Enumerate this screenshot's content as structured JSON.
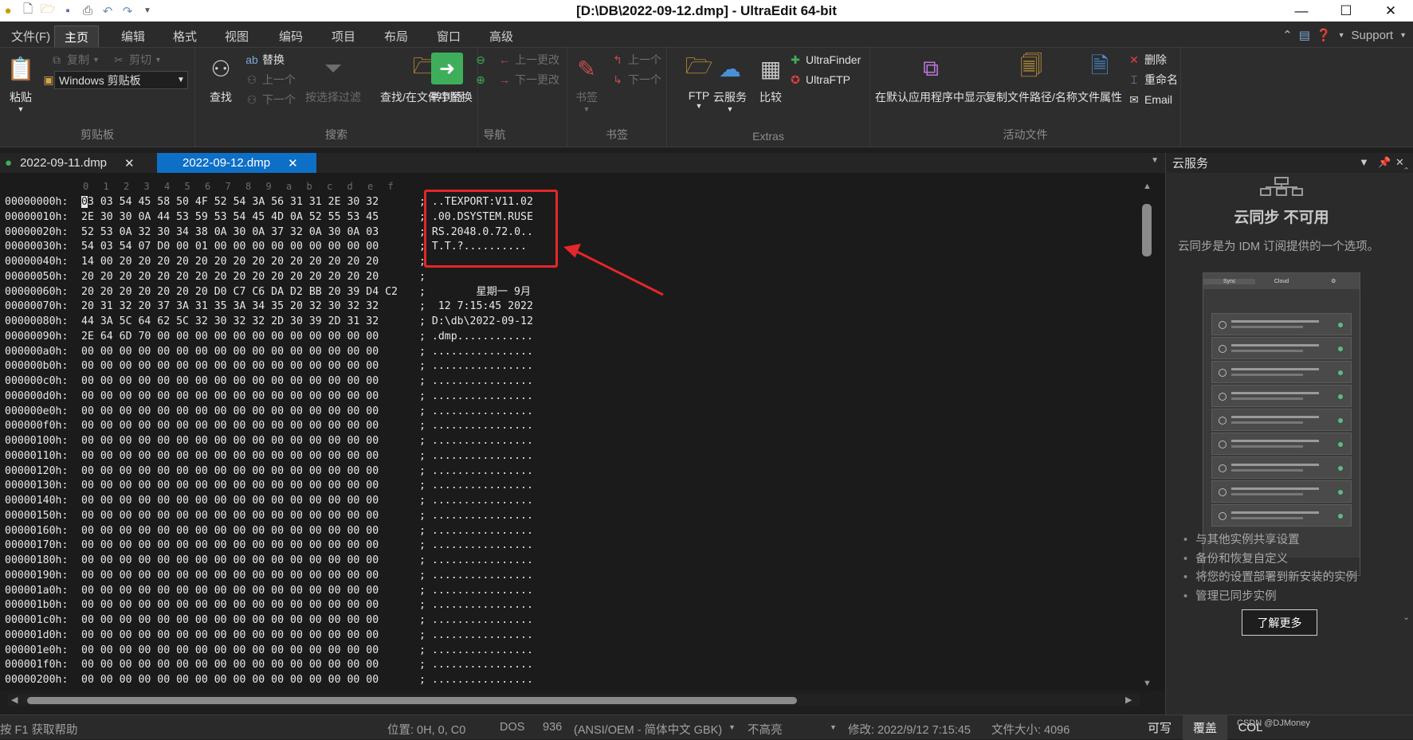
{
  "window": {
    "title": "[D:\\DB\\2022-09-12.dmp] - UltraEdit 64-bit",
    "controls": [
      "—",
      "☐",
      "✕"
    ]
  },
  "menu": {
    "tabs": [
      "文件(F)",
      "主页",
      "编辑",
      "格式",
      "视图",
      "编码",
      "项目",
      "布局",
      "窗口",
      "高级"
    ],
    "active": "主页",
    "support": "Support"
  },
  "ribbon": {
    "clipboard": {
      "label": "剪贴板",
      "paste": "粘贴",
      "copy": "复制",
      "cut": "剪切",
      "combo": "Windows 剪贴板"
    },
    "search": {
      "label": "搜索",
      "find": "查找",
      "replace": "替换",
      "prev": "上一个",
      "next": "下一个",
      "filter": "按选择过滤",
      "find_in_files": "查找/在文件中替换"
    },
    "navigation": {
      "label": "导航",
      "goto": "转到行",
      "prev_change": "上一更改",
      "next_change": "下一更改"
    },
    "bookmarks": {
      "label": "书签",
      "bookmark": "书签",
      "prev": "上一个",
      "next": "下一个"
    },
    "extras": {
      "label": "Extras",
      "ftp": "FTP",
      "cloud": "云服务",
      "compare": "比较",
      "ultrafinder": "UltraFinder",
      "ultraftp": "UltraFTP"
    },
    "active_file": {
      "label": "活动文件",
      "show_default": "在默认应用程序中显示",
      "copy_path": "复制文件路径/名称",
      "properties": "文件属性",
      "delete": "删除",
      "rename": "重命名",
      "email": "Email"
    }
  },
  "documents": [
    {
      "name": "2022-09-11.dmp",
      "active": false
    },
    {
      "name": "2022-09-12.dmp",
      "active": true
    }
  ],
  "editor": {
    "ruler": [
      "0",
      "1",
      "2",
      "3",
      "4",
      "5",
      "6",
      "7",
      "8",
      "9",
      "a",
      "b",
      "c",
      "d",
      "e",
      "f"
    ],
    "rows": [
      {
        "addr": "00000000h:",
        "hex": "03 03 54 45 58 50 4F 52 54 3A 56 31 31 2E 30 32",
        "ascii": "..TEXPORT:V11.02"
      },
      {
        "addr": "00000010h:",
        "hex": "2E 30 30 0A 44 53 59 53 54 45 4D 0A 52 55 53 45",
        "ascii": ".00.DSYSTEM.RUSE"
      },
      {
        "addr": "00000020h:",
        "hex": "52 53 0A 32 30 34 38 0A 30 0A 37 32 0A 30 0A 03",
        "ascii": "RS.2048.0.72.0.."
      },
      {
        "addr": "00000030h:",
        "hex": "54 03 54 07 D0 00 01 00 00 00 00 00 00 00 00 00",
        "ascii": "T.T.?.........."
      },
      {
        "addr": "00000040h:",
        "hex": "14 00 20 20 20 20 20 20 20 20 20 20 20 20 20 20",
        "ascii": ""
      },
      {
        "addr": "00000050h:",
        "hex": "20 20 20 20 20 20 20 20 20 20 20 20 20 20 20 20",
        "ascii": ""
      },
      {
        "addr": "00000060h:",
        "hex": "20 20 20 20 20 20 20 D0 C7 C6 DA D2 BB 20 39 D4 C2",
        "ascii": "       星期一 9月"
      },
      {
        "addr": "00000070h:",
        "hex": "20 31 32 20 37 3A 31 35 3A 34 35 20 32 30 32 32",
        "ascii": " 12 7:15:45 2022"
      },
      {
        "addr": "00000080h:",
        "hex": "44 3A 5C 64 62 5C 32 30 32 32 2D 30 39 2D 31 32",
        "ascii": "D:\\db\\2022-09-12"
      },
      {
        "addr": "00000090h:",
        "hex": "2E 64 6D 70 00 00 00 00 00 00 00 00 00 00 00 00",
        "ascii": ".dmp............"
      },
      {
        "addr": "000000a0h:",
        "hex": "00 00 00 00 00 00 00 00 00 00 00 00 00 00 00 00",
        "ascii": "................"
      },
      {
        "addr": "000000b0h:",
        "hex": "00 00 00 00 00 00 00 00 00 00 00 00 00 00 00 00",
        "ascii": "................"
      },
      {
        "addr": "000000c0h:",
        "hex": "00 00 00 00 00 00 00 00 00 00 00 00 00 00 00 00",
        "ascii": "................"
      },
      {
        "addr": "000000d0h:",
        "hex": "00 00 00 00 00 00 00 00 00 00 00 00 00 00 00 00",
        "ascii": "................"
      },
      {
        "addr": "000000e0h:",
        "hex": "00 00 00 00 00 00 00 00 00 00 00 00 00 00 00 00",
        "ascii": "................"
      },
      {
        "addr": "000000f0h:",
        "hex": "00 00 00 00 00 00 00 00 00 00 00 00 00 00 00 00",
        "ascii": "................"
      },
      {
        "addr": "00000100h:",
        "hex": "00 00 00 00 00 00 00 00 00 00 00 00 00 00 00 00",
        "ascii": "................"
      },
      {
        "addr": "00000110h:",
        "hex": "00 00 00 00 00 00 00 00 00 00 00 00 00 00 00 00",
        "ascii": "................"
      },
      {
        "addr": "00000120h:",
        "hex": "00 00 00 00 00 00 00 00 00 00 00 00 00 00 00 00",
        "ascii": "................"
      },
      {
        "addr": "00000130h:",
        "hex": "00 00 00 00 00 00 00 00 00 00 00 00 00 00 00 00",
        "ascii": "................"
      },
      {
        "addr": "00000140h:",
        "hex": "00 00 00 00 00 00 00 00 00 00 00 00 00 00 00 00",
        "ascii": "................"
      },
      {
        "addr": "00000150h:",
        "hex": "00 00 00 00 00 00 00 00 00 00 00 00 00 00 00 00",
        "ascii": "................"
      },
      {
        "addr": "00000160h:",
        "hex": "00 00 00 00 00 00 00 00 00 00 00 00 00 00 00 00",
        "ascii": "................"
      },
      {
        "addr": "00000170h:",
        "hex": "00 00 00 00 00 00 00 00 00 00 00 00 00 00 00 00",
        "ascii": "................"
      },
      {
        "addr": "00000180h:",
        "hex": "00 00 00 00 00 00 00 00 00 00 00 00 00 00 00 00",
        "ascii": "................"
      },
      {
        "addr": "00000190h:",
        "hex": "00 00 00 00 00 00 00 00 00 00 00 00 00 00 00 00",
        "ascii": "................"
      },
      {
        "addr": "000001a0h:",
        "hex": "00 00 00 00 00 00 00 00 00 00 00 00 00 00 00 00",
        "ascii": "................"
      },
      {
        "addr": "000001b0h:",
        "hex": "00 00 00 00 00 00 00 00 00 00 00 00 00 00 00 00",
        "ascii": "................"
      },
      {
        "addr": "000001c0h:",
        "hex": "00 00 00 00 00 00 00 00 00 00 00 00 00 00 00 00",
        "ascii": "................"
      },
      {
        "addr": "000001d0h:",
        "hex": "00 00 00 00 00 00 00 00 00 00 00 00 00 00 00 00",
        "ascii": "................"
      },
      {
        "addr": "000001e0h:",
        "hex": "00 00 00 00 00 00 00 00 00 00 00 00 00 00 00 00",
        "ascii": "................"
      },
      {
        "addr": "000001f0h:",
        "hex": "00 00 00 00 00 00 00 00 00 00 00 00 00 00 00 00",
        "ascii": "................"
      },
      {
        "addr": "00000200h:",
        "hex": "00 00 00 00 00 00 00 00 00 00 00 00 00 00 00 00",
        "ascii": "................"
      }
    ]
  },
  "panel": {
    "title": "云服务",
    "heading": "云同步 不可用",
    "description": "云同步是为 IDM 订阅提供的一个选项。",
    "preview_tabs": [
      "Sync",
      "Cloud",
      "⚙"
    ],
    "bullets": [
      "与其他实例共享设置",
      "备份和恢复自定义",
      "将您的设置部署到新安装的实例",
      "管理已同步实例"
    ],
    "learn_more": "了解更多"
  },
  "status": {
    "help": "按 F1 获取帮助",
    "position": "位置: 0H, 0, C0",
    "line_ending": "DOS",
    "codepage": "936",
    "encoding": "(ANSI/OEM - 简体中文 GBK)",
    "highlight": "不高亮",
    "modified": "修改:  2022/9/12 7:15:45",
    "filesize": "文件大小:  4096",
    "writable": "可写",
    "overwrite": "覆盖",
    "col": "COL",
    "watermark": "CSDN @DJMoney"
  },
  "colors": {
    "accent_tab": "#0e6fc7",
    "highlight_box": "#e5262a"
  }
}
